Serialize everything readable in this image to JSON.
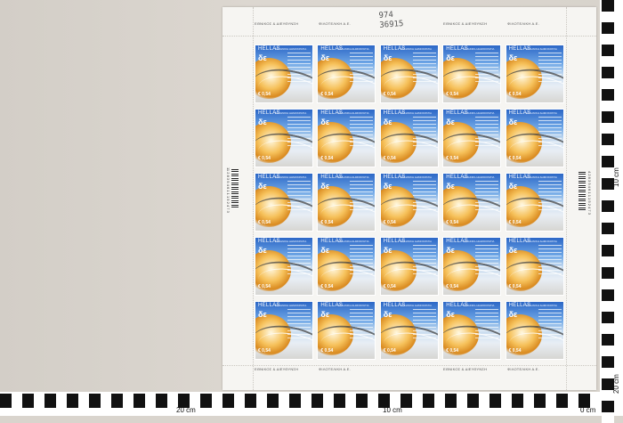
{
  "sheet": {
    "handwritten": [
      "974",
      "36915"
    ],
    "top_margin_left": "ΕΘΝΙΚΟΣ & ΔΙΕΥΘΥΝΣΗ",
    "top_margin_right": "ΦΙΛΟΤΕΛΙΚΗ Α.Ε.",
    "bottom_margin_left": "ΕΘΝΙΚΟΣ & ΔΙΕΥΘΥΝΣΗ",
    "bottom_margin_right": "ΦΙΛΟΤΕΛΙΚΗ Α.Ε.",
    "barcode_left": "11 2 8 3 9 4 6 1 1 1 5 2 4 7 3",
    "barcode_right": "4 2 8 3 9 4 6 1 1 1 5 2 4 7 3",
    "rows": 5,
    "cols": 5
  },
  "stamp": {
    "country": "HELLAS",
    "subtitle": "ΕΛΛΗΝΙΚΗ ΔΗΜΟΚΡΑΤΙΑ",
    "emblem": "δε",
    "value": "€ 0,54",
    "colors": {
      "sky": "#2c67c6",
      "sun": "#f6c15a",
      "ground": "#d98a20"
    }
  },
  "ruler": {
    "bottom_labels": [
      "20 cm",
      "10 cm",
      "0 cm"
    ],
    "right_labels": [
      "10 cm",
      "20 cm"
    ]
  }
}
